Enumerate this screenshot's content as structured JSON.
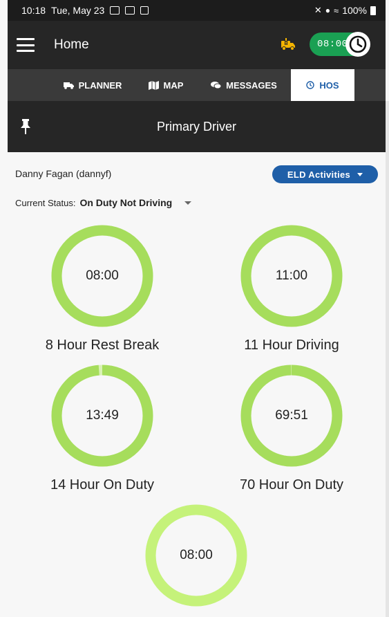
{
  "status_bar": {
    "time": "10:18",
    "date": "Tue, May 23",
    "battery": "100%"
  },
  "app_bar": {
    "title": "Home",
    "duty_time": "08:00",
    "toggle_color": "#1aa053",
    "warning_color": "#f4b400"
  },
  "tabs": [
    {
      "label": "PLANNER",
      "icon": "truck-icon",
      "active": false
    },
    {
      "label": "MAP",
      "icon": "map-icon",
      "active": false
    },
    {
      "label": "MESSAGES",
      "icon": "chat-icon",
      "active": false
    },
    {
      "label": "HOS",
      "icon": "clock-icon",
      "active": true
    }
  ],
  "sub_header": {
    "title": "Primary Driver"
  },
  "driver": {
    "name": "Danny Fagan  (dannyf)"
  },
  "eld_button": {
    "label": "ELD Activities"
  },
  "current_status": {
    "label": "Current Status:",
    "value": "On Duty Not Driving"
  },
  "gauges": [
    {
      "time": "08:00",
      "label": "8 Hour Rest Break",
      "remaining_fraction": 1.0,
      "color": "#a6dd5c"
    },
    {
      "time": "11:00",
      "label": "11 Hour Driving",
      "remaining_fraction": 1.0,
      "color": "#a6dd5c"
    },
    {
      "time": "13:49",
      "label": "14 Hour On Duty",
      "remaining_fraction": 0.988,
      "color": "#a6dd5c"
    },
    {
      "time": "69:51",
      "label": "70 Hour On Duty",
      "remaining_fraction": 0.998,
      "color": "#a6dd5c"
    },
    {
      "time": "08:00",
      "label": "",
      "remaining_fraction": 1.0,
      "color": "#c5f27a"
    }
  ]
}
